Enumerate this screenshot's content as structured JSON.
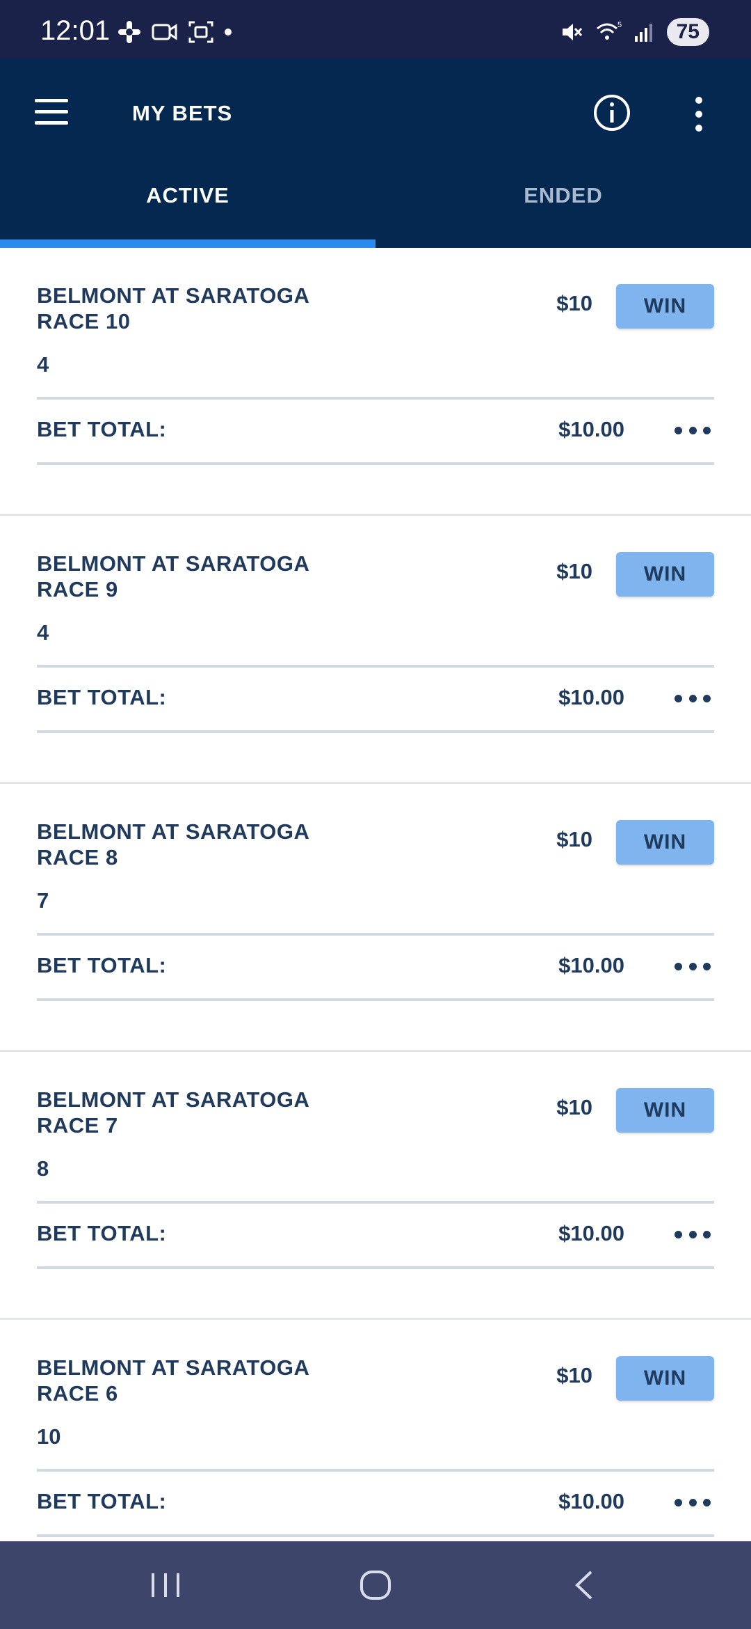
{
  "status_bar": {
    "time": "12:01",
    "left_icons": [
      "slack-icon",
      "video-camera-icon",
      "screenshot-icon",
      "dot-icon"
    ],
    "right_icons": [
      "mute-icon",
      "wifi-icon",
      "signal-icon"
    ],
    "battery": "75"
  },
  "app_bar": {
    "title": "MY BETS",
    "icons": [
      "menu-icon",
      "info-icon",
      "more-vertical-icon"
    ]
  },
  "tabs": [
    {
      "label": "ACTIVE",
      "selected": true
    },
    {
      "label": "ENDED",
      "selected": false
    }
  ],
  "colors": {
    "status_bar": "#1b2249",
    "app_bar": "#042850",
    "tab_indicator": "#2a8bef",
    "bet_type_button": "#7fb4ee",
    "text": "#1f3a5c",
    "nav_bar": "#3d456b"
  },
  "bets": [
    {
      "track": "BELMONT AT SARATOGA",
      "race": "RACE 10",
      "runner": "4",
      "amount": "$10",
      "type": "WIN",
      "total_label": "BET TOTAL:",
      "total": "$10.00"
    },
    {
      "track": "BELMONT AT SARATOGA",
      "race": "RACE 9",
      "runner": "4",
      "amount": "$10",
      "type": "WIN",
      "total_label": "BET TOTAL:",
      "total": "$10.00"
    },
    {
      "track": "BELMONT AT SARATOGA",
      "race": "RACE 8",
      "runner": "7",
      "amount": "$10",
      "type": "WIN",
      "total_label": "BET TOTAL:",
      "total": "$10.00"
    },
    {
      "track": "BELMONT AT SARATOGA",
      "race": "RACE 7",
      "runner": "8",
      "amount": "$10",
      "type": "WIN",
      "total_label": "BET TOTAL:",
      "total": "$10.00"
    },
    {
      "track": "BELMONT AT SARATOGA",
      "race": "RACE 6",
      "runner": "10",
      "amount": "$10",
      "type": "WIN",
      "total_label": "BET TOTAL:",
      "total": "$10.00"
    }
  ],
  "nav_bar": {
    "icons": [
      "recent-apps-icon",
      "home-icon",
      "back-icon"
    ]
  }
}
